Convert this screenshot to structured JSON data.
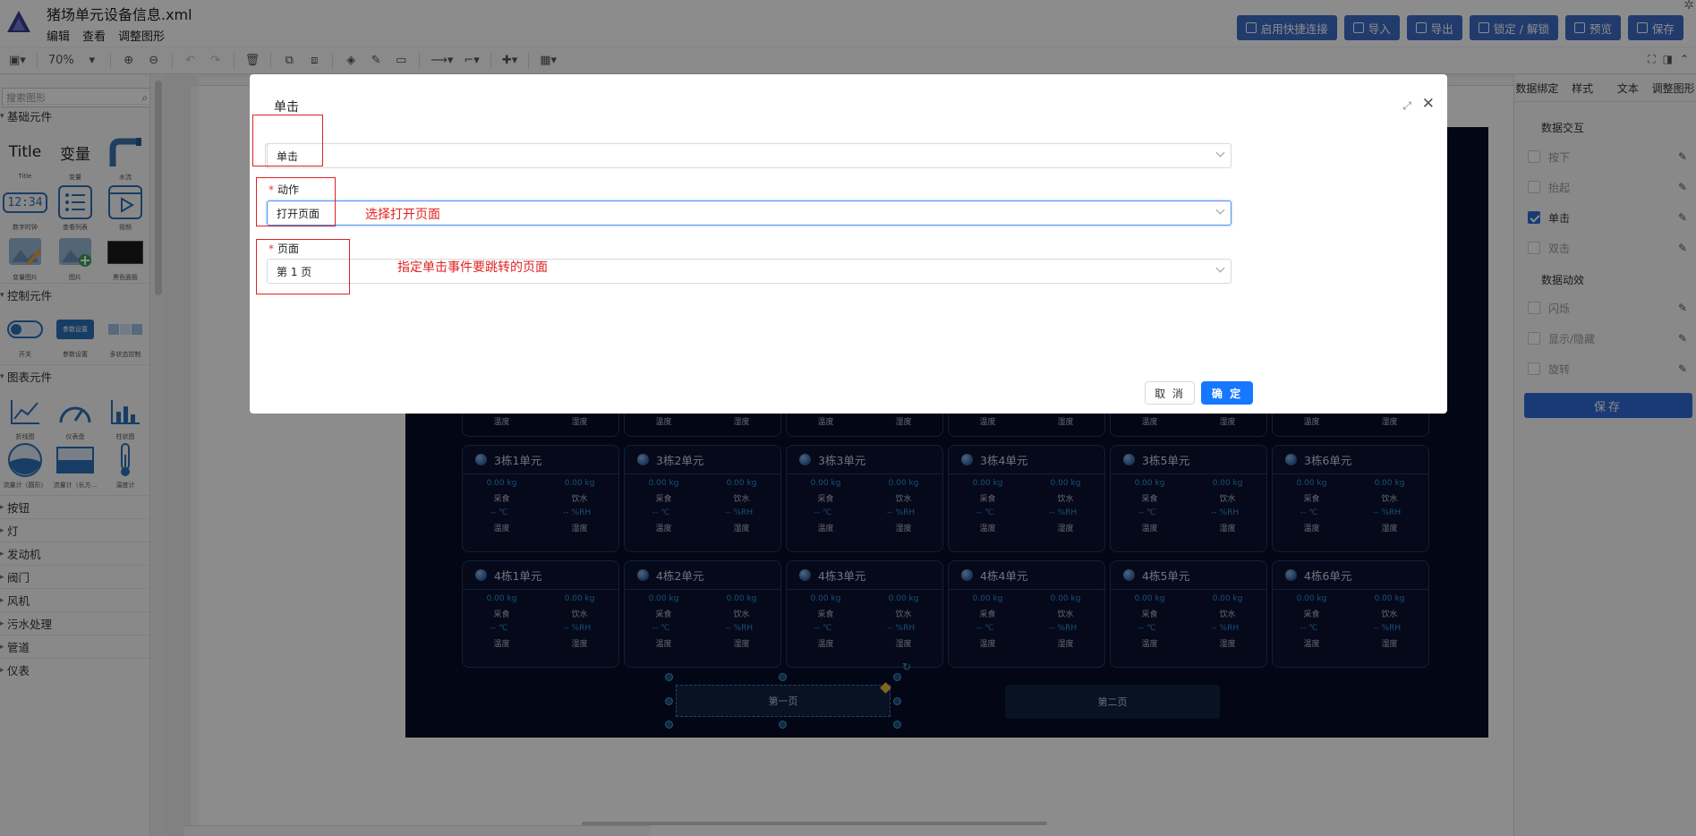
{
  "app": {
    "file_title": "猪场单元设备信息.xml",
    "menu": [
      "编辑",
      "查看",
      "调整图形"
    ],
    "actions": [
      "启用快捷连接",
      "导入",
      "导出",
      "锁定 / 解锁",
      "预览",
      "保存"
    ]
  },
  "toolbar": {
    "zoom": "70%"
  },
  "sidebar": {
    "search_placeholder": "搜索图形",
    "sections": {
      "basic": "基础元件",
      "control": "控制元件",
      "chart": "图表元件"
    },
    "basic_items": [
      "Title",
      "变量",
      "水流",
      "数字时钟",
      "查看列表",
      "视频",
      "变量图片",
      "图片",
      "黑色面板"
    ],
    "basic_item_captions": [
      "Title",
      "变量",
      "水流",
      "数字时钟",
      "查看列表",
      "视频",
      "变量图片",
      "图片",
      "黑色面板"
    ],
    "clock_text": "12:34",
    "control_items": [
      "开关",
      "参数设置",
      "多状态控制"
    ],
    "param_button_text": "参数设置",
    "chart_items": [
      "折线图",
      "仪表盘",
      "柱状图",
      "流量计（圆形）",
      "流量计（长方...",
      "温度计"
    ],
    "collapsed": [
      "按钮",
      "灯",
      "发动机",
      "阀门",
      "风机",
      "污水处理",
      "管道",
      "仪表"
    ]
  },
  "right_panel": {
    "tabs": [
      "数据绑定",
      "样式",
      "文本",
      "调整图形"
    ],
    "group1": "数据交互",
    "group1_items": [
      {
        "label": "按下",
        "checked": false
      },
      {
        "label": "抬起",
        "checked": false
      },
      {
        "label": "单击",
        "checked": true
      },
      {
        "label": "双击",
        "checked": false
      }
    ],
    "group2": "数据动效",
    "group2_items": [
      {
        "label": "闪烁",
        "checked": false
      },
      {
        "label": "显示/隐藏",
        "checked": false
      },
      {
        "label": "旋转",
        "checked": false
      }
    ],
    "save": "保存"
  },
  "board": {
    "row3": [
      "3栋1单元",
      "3栋2单元",
      "3栋3单元",
      "3栋4单元",
      "3栋5单元",
      "3栋6单元"
    ],
    "row4": [
      "4栋1单元",
      "4栋2单元",
      "4栋3单元",
      "4栋4单元",
      "4栋5单元",
      "4栋6单元"
    ],
    "weight_value": "0.00 kg",
    "feed_label": "采食",
    "water_label": "饮水",
    "temp_value": "--  ℃",
    "humidity_value": "--  %RH",
    "temp_label": "温度",
    "humidity_label": "湿度",
    "page_buttons": [
      "第一页",
      "第二页"
    ]
  },
  "dialog": {
    "title": "单击",
    "fields": [
      {
        "label": "单击",
        "value": "单击"
      },
      {
        "label": "动作",
        "value": "打开页面"
      },
      {
        "label": "页面",
        "value": "第 1 页"
      }
    ],
    "notes": [
      "选择打开页面",
      "指定单击事件要跳转的页面"
    ],
    "cancel": "取 消",
    "ok": "确 定"
  }
}
